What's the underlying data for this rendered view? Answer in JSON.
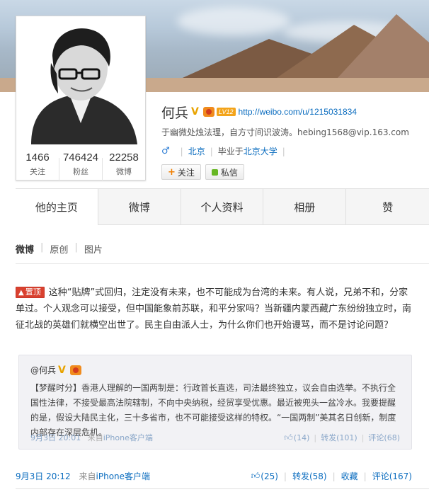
{
  "profile": {
    "name": "何兵",
    "vip_label": "LV12",
    "url": "http://weibo.com/u/1215031834",
    "description": "于幽微处烛法理，自方寸间识波涛。hebing1568@vip.163.com",
    "location": "北京",
    "education_prefix": "毕业于",
    "school": "北京大学",
    "follow_label": "关注",
    "message_label": "私信"
  },
  "stats": [
    {
      "value": "1466",
      "label": "关注"
    },
    {
      "value": "746424",
      "label": "粉丝"
    },
    {
      "value": "22258",
      "label": "微博"
    }
  ],
  "tabs": [
    {
      "label": "他的主页"
    },
    {
      "label": "微博"
    },
    {
      "label": "个人资料"
    },
    {
      "label": "相册"
    },
    {
      "label": "赞"
    }
  ],
  "feed": {
    "subtabs": [
      "微博",
      "原创",
      "图片"
    ],
    "post": {
      "pin_label": "置顶",
      "text": "这种“贴牌”式回归，注定没有未来，也不可能成为台湾的未来。有人说，兄弟不和，分家单过。个人观念可以接受，但中国能象前苏联，和平分家吗？当新疆内蒙西藏广东纷纷独立时，南征北战的英雄们就横空出世了。民主自由派人士，为什么你们也开始谩骂，而不是讨论问题？",
      "time": "9月3日 20:12",
      "source_prefix": "来自",
      "source": "iPhone客户端",
      "like": "(25)",
      "repost": "转发(58)",
      "favorite": "收藏",
      "comment": "评论(167)"
    },
    "quote": {
      "author": "@何兵",
      "text": "【梦醒时分】香港人理解的一国两制是：行政首长直选，司法最终独立，议会自由选举。不执行全国性法律，不接受最高法院辖制，不向中央纳税，经贸享受优惠。最近被兜头一盆冷水。我要提醒的是，假设大陆民主化，三十多省市，也不可能接受这样的特权。“一国两制”美其名日创新，制度内部存在深层危机。",
      "time": "9月3日 20:01",
      "source_prefix": "来自",
      "source": "iPhone客户端",
      "like": "(14)",
      "repost": "转发(101)",
      "comment": "评论(68)"
    }
  },
  "colors": {
    "link": "#0a6cbf",
    "pin": "#d9412f",
    "verified": "#e8a300"
  }
}
